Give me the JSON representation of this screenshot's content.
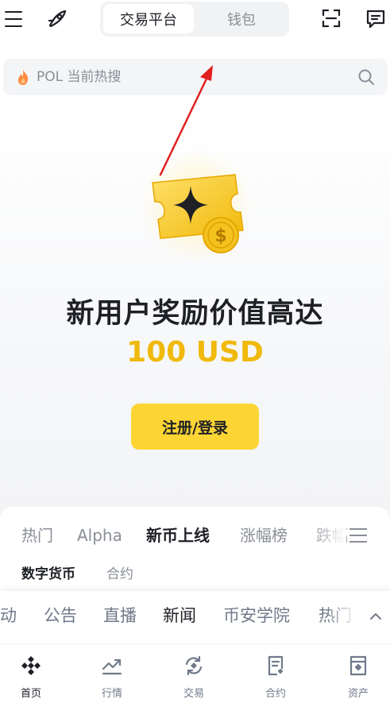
{
  "header": {
    "tabs": [
      {
        "label": "交易平台",
        "active": true
      },
      {
        "label": "钱包",
        "active": false
      }
    ]
  },
  "search": {
    "placeholder": "POL 当前热搜"
  },
  "promo": {
    "headline": "新用户奖励价值高达",
    "amount": "100 USD",
    "cta_label": "注册/登录"
  },
  "market": {
    "tabs": [
      "热门",
      "Alpha",
      "新币上线",
      "涨幅榜",
      "跌幅"
    ],
    "active_tab": "新币上线",
    "subtabs": [
      "数字货币",
      "合约"
    ],
    "active_subtab": "数字货币"
  },
  "news": {
    "tabs": [
      "动",
      "公告",
      "直播",
      "新闻",
      "币安学院",
      "热门"
    ],
    "active_tab": "新闻"
  },
  "bottom_nav": {
    "items": [
      {
        "label": "首页",
        "icon": "home-diamond-icon",
        "active": true
      },
      {
        "label": "行情",
        "icon": "chart-trend-icon",
        "active": false
      },
      {
        "label": "交易",
        "icon": "exchange-icon",
        "active": false
      },
      {
        "label": "合约",
        "icon": "contract-icon",
        "active": false
      },
      {
        "label": "资产",
        "icon": "wallet-icon",
        "active": false
      }
    ]
  },
  "colors": {
    "brand": "#fcd535",
    "accent_text": "#f0b90b",
    "annotation_arrow": "#e02020"
  }
}
